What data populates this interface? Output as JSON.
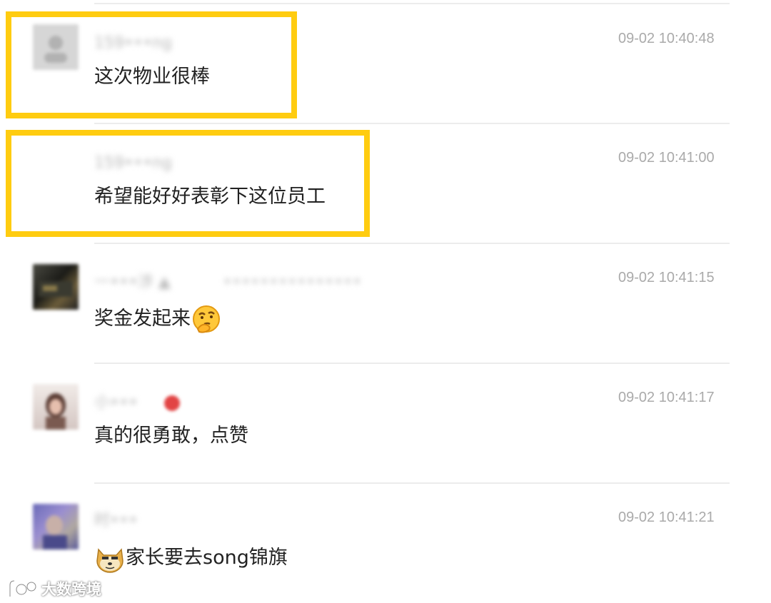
{
  "comments": [
    {
      "username": "159•••ng",
      "text": "这次物业很棒",
      "time": "09-02 10:40:48",
      "highlighted": true,
      "avatar_icon": "default-avatar-icon"
    },
    {
      "username": "159•••ng",
      "text": "希望能好好表彰下这位员工",
      "time": "09-02 10:41:00",
      "highlighted": true,
      "avatar_icon": "none"
    },
    {
      "username": "一•••涉 ▲",
      "username_extra": "•••••••••••••••",
      "text": "奖金发起来",
      "emoji": "thinking-face-icon",
      "time": "09-02 10:41:15",
      "highlighted": false,
      "avatar_icon": "dark-photo-avatar"
    },
    {
      "username": "小•••",
      "text": "真的很勇敢，点赞",
      "time": "09-02 10:41:17",
      "highlighted": false,
      "avatar_icon": "girl-photo-avatar"
    },
    {
      "username": "时•••",
      "text": "家长要去song锦旗",
      "emoji": "doge-icon",
      "time": "09-02 10:41:21",
      "highlighted": false,
      "avatar_icon": "purple-photo-avatar"
    }
  ],
  "watermark": {
    "text": "大数跨境",
    "icon": "brand-logo-icon"
  },
  "colors": {
    "highlight": "#ffcc10",
    "time": "#aaaaaa",
    "text": "#222222",
    "divider": "#ececec"
  }
}
